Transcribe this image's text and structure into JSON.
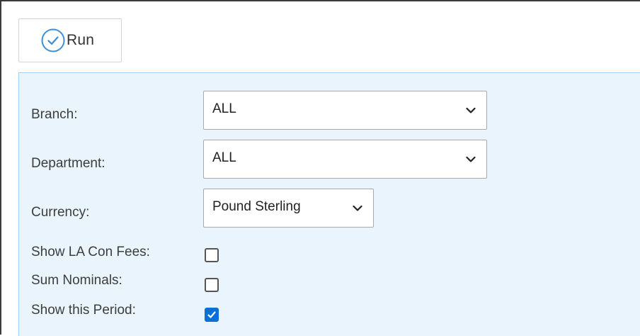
{
  "toolbar": {
    "run_label": "Run",
    "run_icon": "check-circle-icon",
    "accent_color": "#3b8fd9"
  },
  "form": {
    "panel_background": "#e9f4fc",
    "branch": {
      "label": "Branch:",
      "value": "ALL"
    },
    "department": {
      "label": "Department:",
      "value": "ALL"
    },
    "currency": {
      "label": "Currency:",
      "value": "Pound Sterling"
    },
    "show_la_con_fees": {
      "label": "Show LA Con Fees:",
      "checked": false
    },
    "sum_nominals": {
      "label": "Sum Nominals:",
      "checked": false
    },
    "show_this_period": {
      "label": "Show this Period:",
      "checked": true,
      "check_color": "#0a6fd6"
    }
  }
}
